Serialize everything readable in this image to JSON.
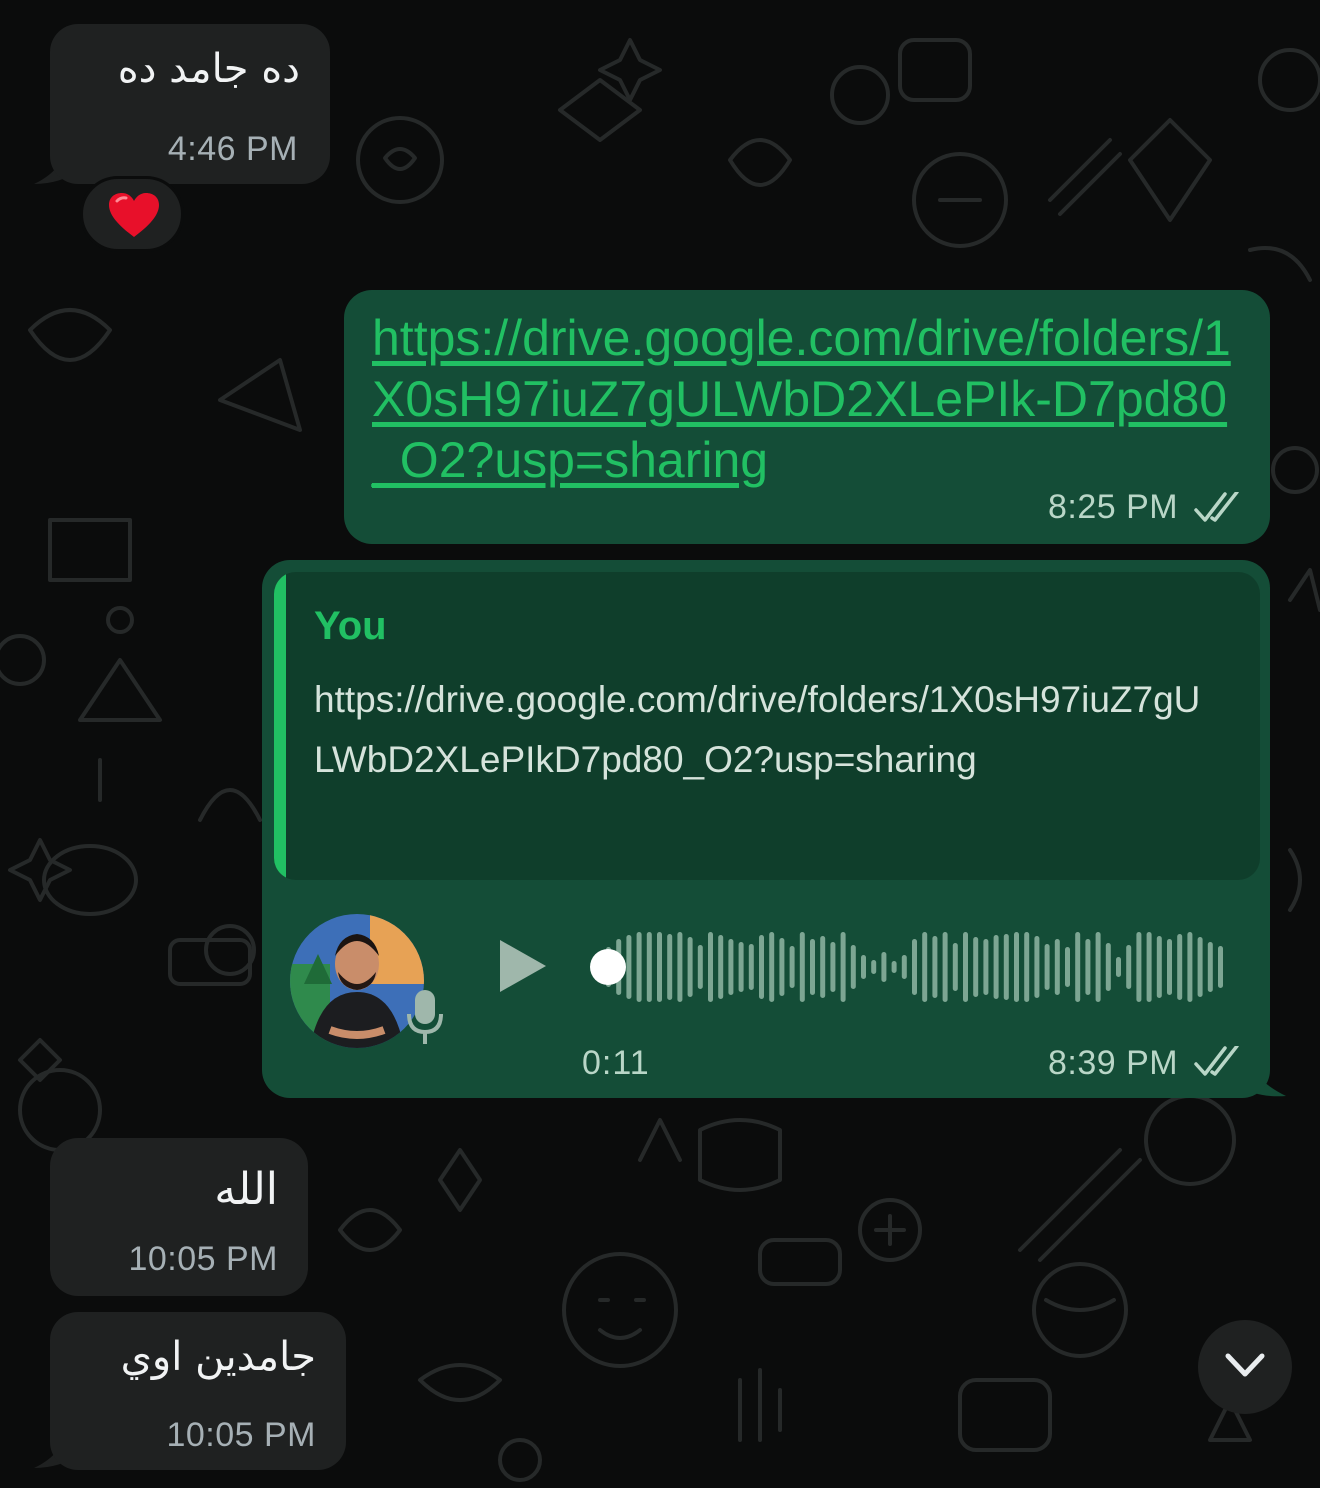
{
  "colors": {
    "background": "#0b0c0c",
    "incoming_bubble": "#1f2121",
    "outgoing_bubble": "#144d37",
    "quote_background": "#0f3e2b",
    "accent_green": "#21c063"
  },
  "messages": [
    {
      "direction": "incoming",
      "text": "ده جامد ده",
      "time": "4:46 PM",
      "reaction": "❤️"
    },
    {
      "direction": "outgoing",
      "link": "https://drive.google.com/drive/folders/1X0sH97iuZ7gULWbD2XLePIk-D7pd80_O2?usp=sharing",
      "time": "8:25 PM",
      "status_icon": "double-check-icon"
    },
    {
      "direction": "outgoing",
      "type": "voice_reply",
      "quoted_author": "You",
      "quoted_text": "https://drive.google.com/drive/folders/1X0sH97iuZ7gULWbD2XLePIkD7pd80_O2?usp=sharing",
      "voice_duration": "0:11",
      "voice_progress": 0,
      "time": "8:39 PM",
      "status_icon": "double-check-icon"
    },
    {
      "direction": "incoming",
      "text": "الله",
      "time": "10:05 PM"
    },
    {
      "direction": "incoming",
      "text": "جامدين اوي",
      "time": "10:05 PM"
    }
  ],
  "scroll_button": {
    "icon": "chevron-down-icon"
  }
}
